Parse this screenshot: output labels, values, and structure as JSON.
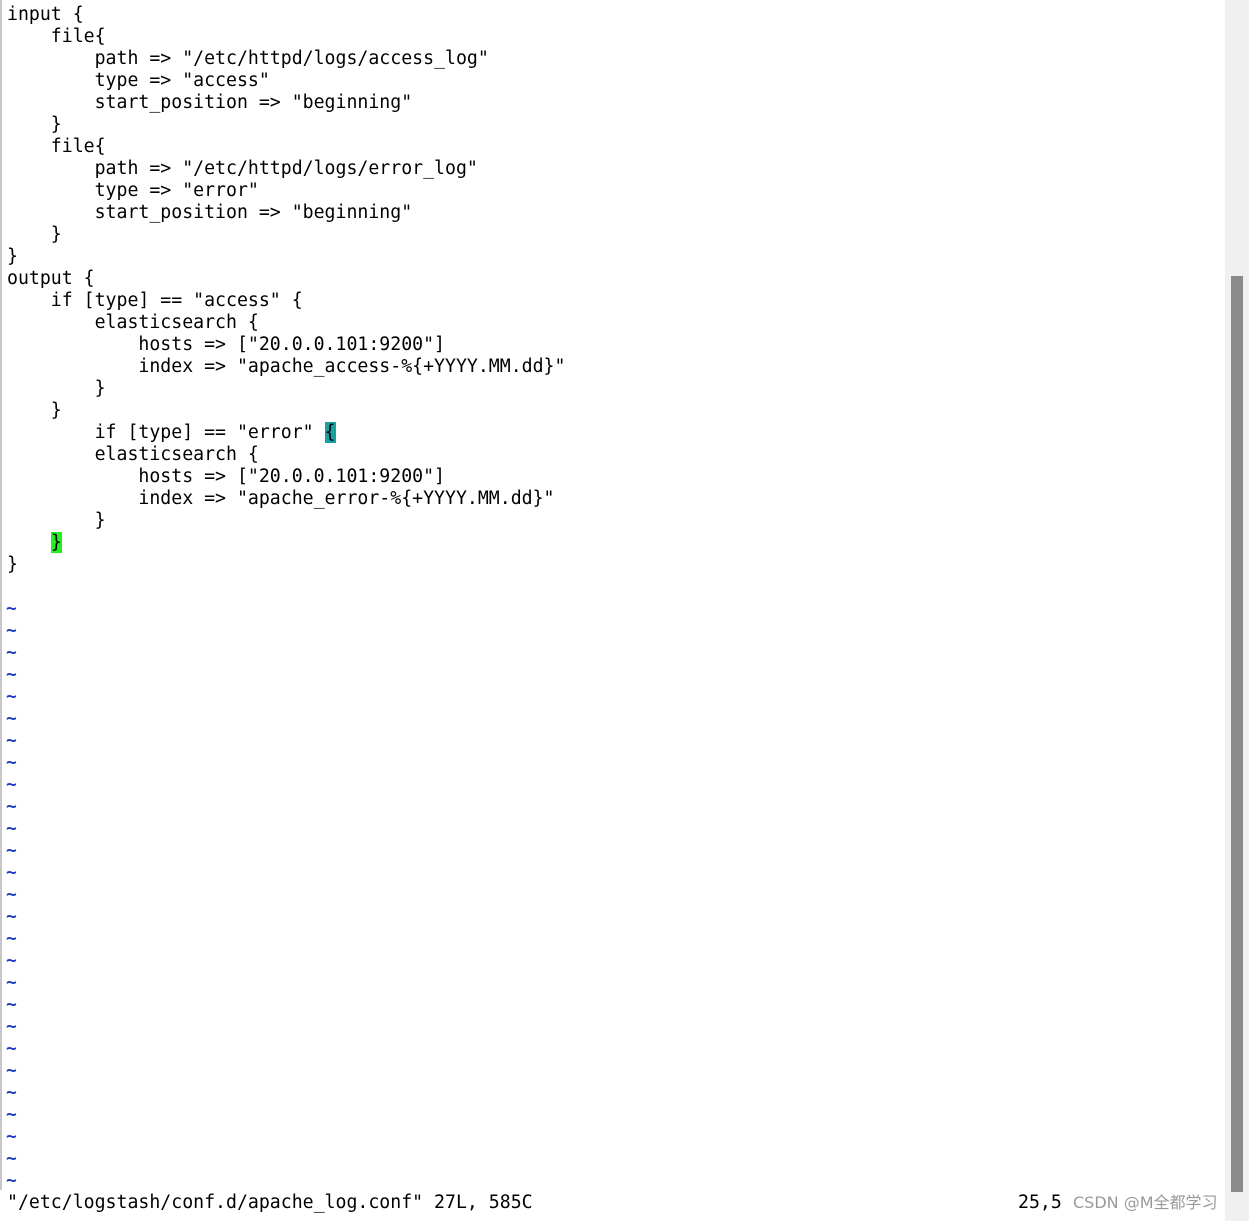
{
  "editor": {
    "lines": [
      "input {",
      "    file{",
      "        path => \"/etc/httpd/logs/access_log\"",
      "        type => \"access\"",
      "        start_position => \"beginning\"",
      "    }",
      "    file{",
      "        path => \"/etc/httpd/logs/error_log\"",
      "        type => \"error\"",
      "        start_position => \"beginning\"",
      "    }",
      "}",
      "output {",
      "    if [type] == \"access\" {",
      "        elasticsearch {",
      "            hosts => [\"20.0.0.101:9200\"]",
      "            index => \"apache_access-%{+YYYY.MM.dd}\"",
      "        }",
      "    }",
      "        if [type] == \"error\" ",
      "        elasticsearch {",
      "            hosts => [\"20.0.0.101:9200\"]",
      "            index => \"apache_error-%{+YYYY.MM.dd}\"",
      "        }",
      "    ",
      "}"
    ],
    "bracket_cursor": "{",
    "bracket_match": "}",
    "empty_line_marker": "~"
  },
  "status": {
    "file_info": "\"/etc/logstash/conf.d/apache_log.conf\" 27L, 585C",
    "cursor_position": "25,5"
  },
  "watermark": "CSDN @M全都学习",
  "colors": {
    "tilde": "#1e3cc8",
    "cursor_highlight": "#17a2a2",
    "match_highlight": "#22ee22"
  }
}
